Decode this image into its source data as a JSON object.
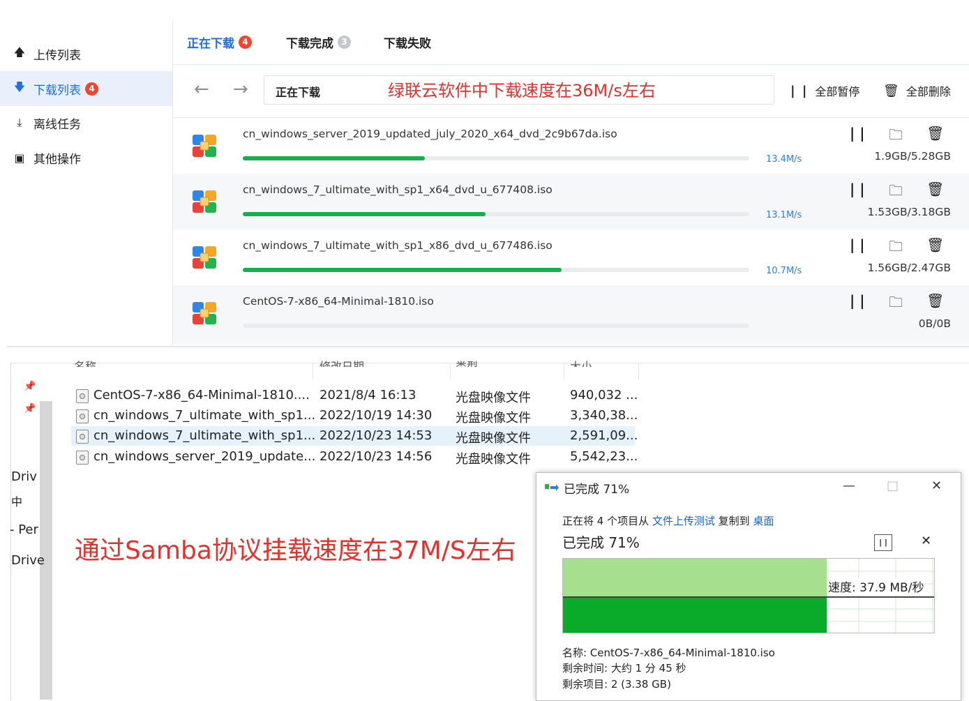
{
  "sidebar": {
    "items": [
      {
        "label": "上传列表",
        "icon": "arrow-up-icon"
      },
      {
        "label": "下载列表",
        "icon": "arrow-down-icon",
        "badge": "4"
      },
      {
        "label": "离线任务",
        "icon": "download-bar-icon"
      },
      {
        "label": "其他操作",
        "icon": "briefcase-icon"
      }
    ]
  },
  "tabs": [
    {
      "label": "正在下载",
      "badge": "4"
    },
    {
      "label": "下载完成",
      "badge": "3"
    },
    {
      "label": "下载失败"
    }
  ],
  "navbar": {
    "path": "正在下载",
    "pause_all": "全部暂停",
    "delete_all": "全部删除"
  },
  "annotations": {
    "app": "绿联云软件中下载速度在36M/s左右",
    "samba": "通过Samba协议挂载速度在37M/S左右"
  },
  "downloads": [
    {
      "name": "cn_windows_server_2019_updated_july_2020_x64_dvd_2c9b67da.iso",
      "speed": "13.4M/s",
      "size": "1.9GB/5.28GB",
      "progress": 0.36
    },
    {
      "name": "cn_windows_7_ultimate_with_sp1_x64_dvd_u_677408.iso",
      "speed": "13.1M/s",
      "size": "1.53GB/3.18GB",
      "progress": 0.48
    },
    {
      "name": "cn_windows_7_ultimate_with_sp1_x86_dvd_u_677486.iso",
      "speed": "10.7M/s",
      "size": "1.56GB/2.47GB",
      "progress": 0.63
    },
    {
      "name": "CentOS-7-x86_64-Minimal-1810.iso",
      "speed": "",
      "size": "0B/0B",
      "progress": 0
    }
  ],
  "explorer": {
    "headers": [
      "名称",
      "修改日期",
      "类型",
      "大小"
    ],
    "files": [
      {
        "name": "CentOS-7-x86_64-Minimal-1810....",
        "date": "2021/8/4 16:13",
        "type": "光盘映像文件",
        "size": "940,032 ..."
      },
      {
        "name": "cn_windows_7_ultimate_with_sp1...",
        "date": "2022/10/19 14:30",
        "type": "光盘映像文件",
        "size": "3,340,38..."
      },
      {
        "name": "cn_windows_7_ultimate_with_sp1...",
        "date": "2022/10/23 14:53",
        "type": "光盘映像文件",
        "size": "2,591,09..."
      },
      {
        "name": "cn_windows_server_2019_update...",
        "date": "2022/10/23 14:56",
        "type": "光盘映像文件",
        "size": "5,542,23..."
      }
    ],
    "nav": [
      "Driv",
      "中",
      "- Per",
      "Drive"
    ]
  },
  "dialog": {
    "title": "已完成 71%",
    "line_prefix": "正在将 4 个项目从",
    "source": "文件上传测试",
    "line_mid": "复制到",
    "dest": "桌面",
    "percent": "已完成 71%",
    "speed": "速度: 37.9 MB/秒",
    "name": "名称: CentOS-7-x86_64-Minimal-1810.iso",
    "remaining_time": "剩余时间: 大约 1 分 45 秒",
    "remaining_items": "剩余项目: 2 (3.38 GB)",
    "progress": 0.71
  },
  "colors": {
    "accent": "#1f6fe0",
    "progress": "#13b04b",
    "annotation": "#e8302a",
    "badge": "#f0452f",
    "copy_graph": "#0aaa2a"
  }
}
